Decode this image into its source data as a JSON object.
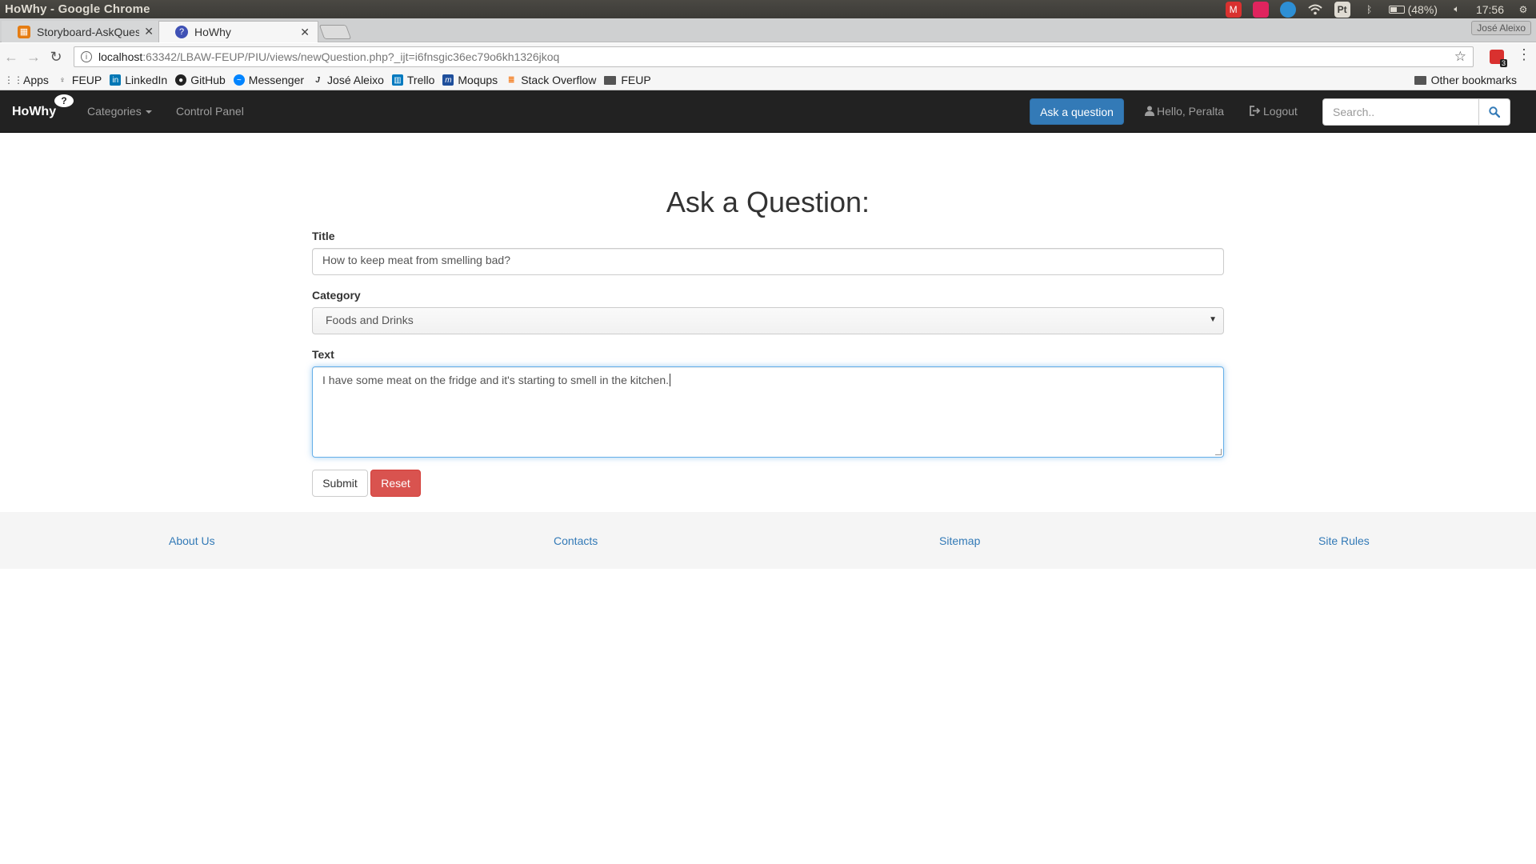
{
  "os": {
    "window_title": "HoWhy - Google Chrome",
    "battery": "(48%)",
    "time": "17:56"
  },
  "browser": {
    "tabs": [
      {
        "label": "Storyboard-AskQuest",
        "active": false
      },
      {
        "label": "HoWhy",
        "active": true
      }
    ],
    "profile": "José Aleixo",
    "url_host": "localhost",
    "url_rest": ":63342/LBAW-FEUP/PIU/views/newQuestion.php?_ijt=i6fnsgic36ec79o6kh1326jkoq",
    "extension_badge": "3",
    "bookmarks": [
      {
        "label": "Apps",
        "icon": "apps-grid-icon"
      },
      {
        "label": "FEUP",
        "icon": "feup-icon"
      },
      {
        "label": "LinkedIn",
        "icon": "linkedin-icon"
      },
      {
        "label": "GitHub",
        "icon": "github-icon"
      },
      {
        "label": "Messenger",
        "icon": "messenger-icon"
      },
      {
        "label": "José Aleixo",
        "icon": "j-icon"
      },
      {
        "label": "Trello",
        "icon": "trello-icon"
      },
      {
        "label": "Moqups",
        "icon": "moqups-icon"
      },
      {
        "label": "Stack Overflow",
        "icon": "stackoverflow-icon"
      },
      {
        "label": "FEUP",
        "icon": "folder-icon"
      }
    ],
    "other_bookmarks": "Other bookmarks"
  },
  "navbar": {
    "brand": "HoWhy",
    "brand_bubble": "?",
    "categories": "Categories",
    "control_panel": "Control Panel",
    "ask_button": "Ask a question",
    "greeting": "Hello, Peralta",
    "logout": "Logout",
    "search_placeholder": "Search.."
  },
  "form": {
    "heading": "Ask a Question:",
    "title_label": "Title",
    "title_value": "How to keep meat from smelling bad?",
    "category_label": "Category",
    "category_value": "Foods and Drinks",
    "text_label": "Text",
    "text_value": "I have some meat on the fridge and it's starting to smell in the kitchen.",
    "submit": "Submit",
    "reset": "Reset"
  },
  "footer": {
    "links": [
      "About Us",
      "Contacts",
      "Sitemap",
      "Site Rules"
    ]
  },
  "colors": {
    "navbar_bg": "#222222",
    "primary": "#337ab7",
    "danger": "#d9534f",
    "link": "#337ab7",
    "footer_bg": "#f5f5f5"
  }
}
